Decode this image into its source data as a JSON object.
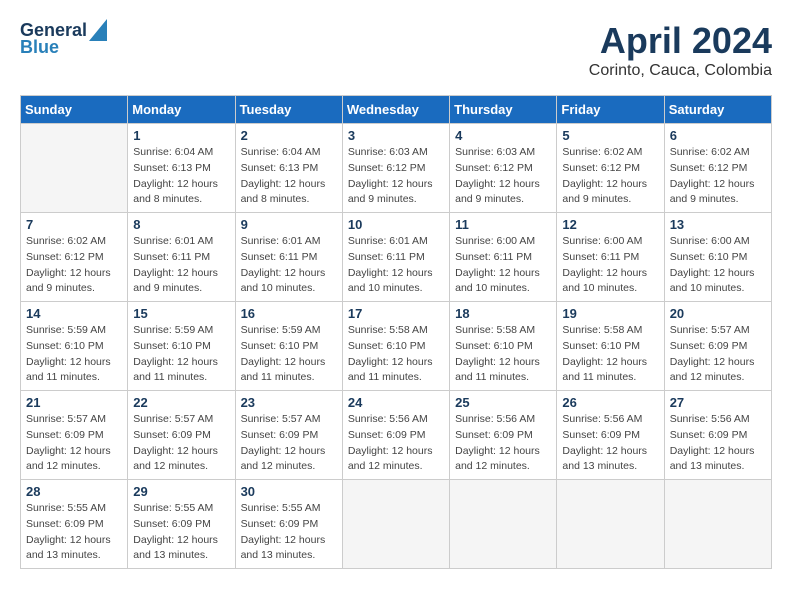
{
  "header": {
    "logo_general": "General",
    "logo_blue": "Blue",
    "title": "April 2024",
    "location": "Corinto, Cauca, Colombia"
  },
  "days_of_week": [
    "Sunday",
    "Monday",
    "Tuesday",
    "Wednesday",
    "Thursday",
    "Friday",
    "Saturday"
  ],
  "weeks": [
    [
      {
        "day": "",
        "info": ""
      },
      {
        "day": "1",
        "info": "Sunrise: 6:04 AM\nSunset: 6:13 PM\nDaylight: 12 hours\nand 8 minutes."
      },
      {
        "day": "2",
        "info": "Sunrise: 6:04 AM\nSunset: 6:13 PM\nDaylight: 12 hours\nand 8 minutes."
      },
      {
        "day": "3",
        "info": "Sunrise: 6:03 AM\nSunset: 6:12 PM\nDaylight: 12 hours\nand 9 minutes."
      },
      {
        "day": "4",
        "info": "Sunrise: 6:03 AM\nSunset: 6:12 PM\nDaylight: 12 hours\nand 9 minutes."
      },
      {
        "day": "5",
        "info": "Sunrise: 6:02 AM\nSunset: 6:12 PM\nDaylight: 12 hours\nand 9 minutes."
      },
      {
        "day": "6",
        "info": "Sunrise: 6:02 AM\nSunset: 6:12 PM\nDaylight: 12 hours\nand 9 minutes."
      }
    ],
    [
      {
        "day": "7",
        "info": "Sunrise: 6:02 AM\nSunset: 6:12 PM\nDaylight: 12 hours\nand 9 minutes."
      },
      {
        "day": "8",
        "info": "Sunrise: 6:01 AM\nSunset: 6:11 PM\nDaylight: 12 hours\nand 9 minutes."
      },
      {
        "day": "9",
        "info": "Sunrise: 6:01 AM\nSunset: 6:11 PM\nDaylight: 12 hours\nand 10 minutes."
      },
      {
        "day": "10",
        "info": "Sunrise: 6:01 AM\nSunset: 6:11 PM\nDaylight: 12 hours\nand 10 minutes."
      },
      {
        "day": "11",
        "info": "Sunrise: 6:00 AM\nSunset: 6:11 PM\nDaylight: 12 hours\nand 10 minutes."
      },
      {
        "day": "12",
        "info": "Sunrise: 6:00 AM\nSunset: 6:11 PM\nDaylight: 12 hours\nand 10 minutes."
      },
      {
        "day": "13",
        "info": "Sunrise: 6:00 AM\nSunset: 6:10 PM\nDaylight: 12 hours\nand 10 minutes."
      }
    ],
    [
      {
        "day": "14",
        "info": "Sunrise: 5:59 AM\nSunset: 6:10 PM\nDaylight: 12 hours\nand 11 minutes."
      },
      {
        "day": "15",
        "info": "Sunrise: 5:59 AM\nSunset: 6:10 PM\nDaylight: 12 hours\nand 11 minutes."
      },
      {
        "day": "16",
        "info": "Sunrise: 5:59 AM\nSunset: 6:10 PM\nDaylight: 12 hours\nand 11 minutes."
      },
      {
        "day": "17",
        "info": "Sunrise: 5:58 AM\nSunset: 6:10 PM\nDaylight: 12 hours\nand 11 minutes."
      },
      {
        "day": "18",
        "info": "Sunrise: 5:58 AM\nSunset: 6:10 PM\nDaylight: 12 hours\nand 11 minutes."
      },
      {
        "day": "19",
        "info": "Sunrise: 5:58 AM\nSunset: 6:10 PM\nDaylight: 12 hours\nand 11 minutes."
      },
      {
        "day": "20",
        "info": "Sunrise: 5:57 AM\nSunset: 6:09 PM\nDaylight: 12 hours\nand 12 minutes."
      }
    ],
    [
      {
        "day": "21",
        "info": "Sunrise: 5:57 AM\nSunset: 6:09 PM\nDaylight: 12 hours\nand 12 minutes."
      },
      {
        "day": "22",
        "info": "Sunrise: 5:57 AM\nSunset: 6:09 PM\nDaylight: 12 hours\nand 12 minutes."
      },
      {
        "day": "23",
        "info": "Sunrise: 5:57 AM\nSunset: 6:09 PM\nDaylight: 12 hours\nand 12 minutes."
      },
      {
        "day": "24",
        "info": "Sunrise: 5:56 AM\nSunset: 6:09 PM\nDaylight: 12 hours\nand 12 minutes."
      },
      {
        "day": "25",
        "info": "Sunrise: 5:56 AM\nSunset: 6:09 PM\nDaylight: 12 hours\nand 12 minutes."
      },
      {
        "day": "26",
        "info": "Sunrise: 5:56 AM\nSunset: 6:09 PM\nDaylight: 12 hours\nand 13 minutes."
      },
      {
        "day": "27",
        "info": "Sunrise: 5:56 AM\nSunset: 6:09 PM\nDaylight: 12 hours\nand 13 minutes."
      }
    ],
    [
      {
        "day": "28",
        "info": "Sunrise: 5:55 AM\nSunset: 6:09 PM\nDaylight: 12 hours\nand 13 minutes."
      },
      {
        "day": "29",
        "info": "Sunrise: 5:55 AM\nSunset: 6:09 PM\nDaylight: 12 hours\nand 13 minutes."
      },
      {
        "day": "30",
        "info": "Sunrise: 5:55 AM\nSunset: 6:09 PM\nDaylight: 12 hours\nand 13 minutes."
      },
      {
        "day": "",
        "info": ""
      },
      {
        "day": "",
        "info": ""
      },
      {
        "day": "",
        "info": ""
      },
      {
        "day": "",
        "info": ""
      }
    ]
  ]
}
